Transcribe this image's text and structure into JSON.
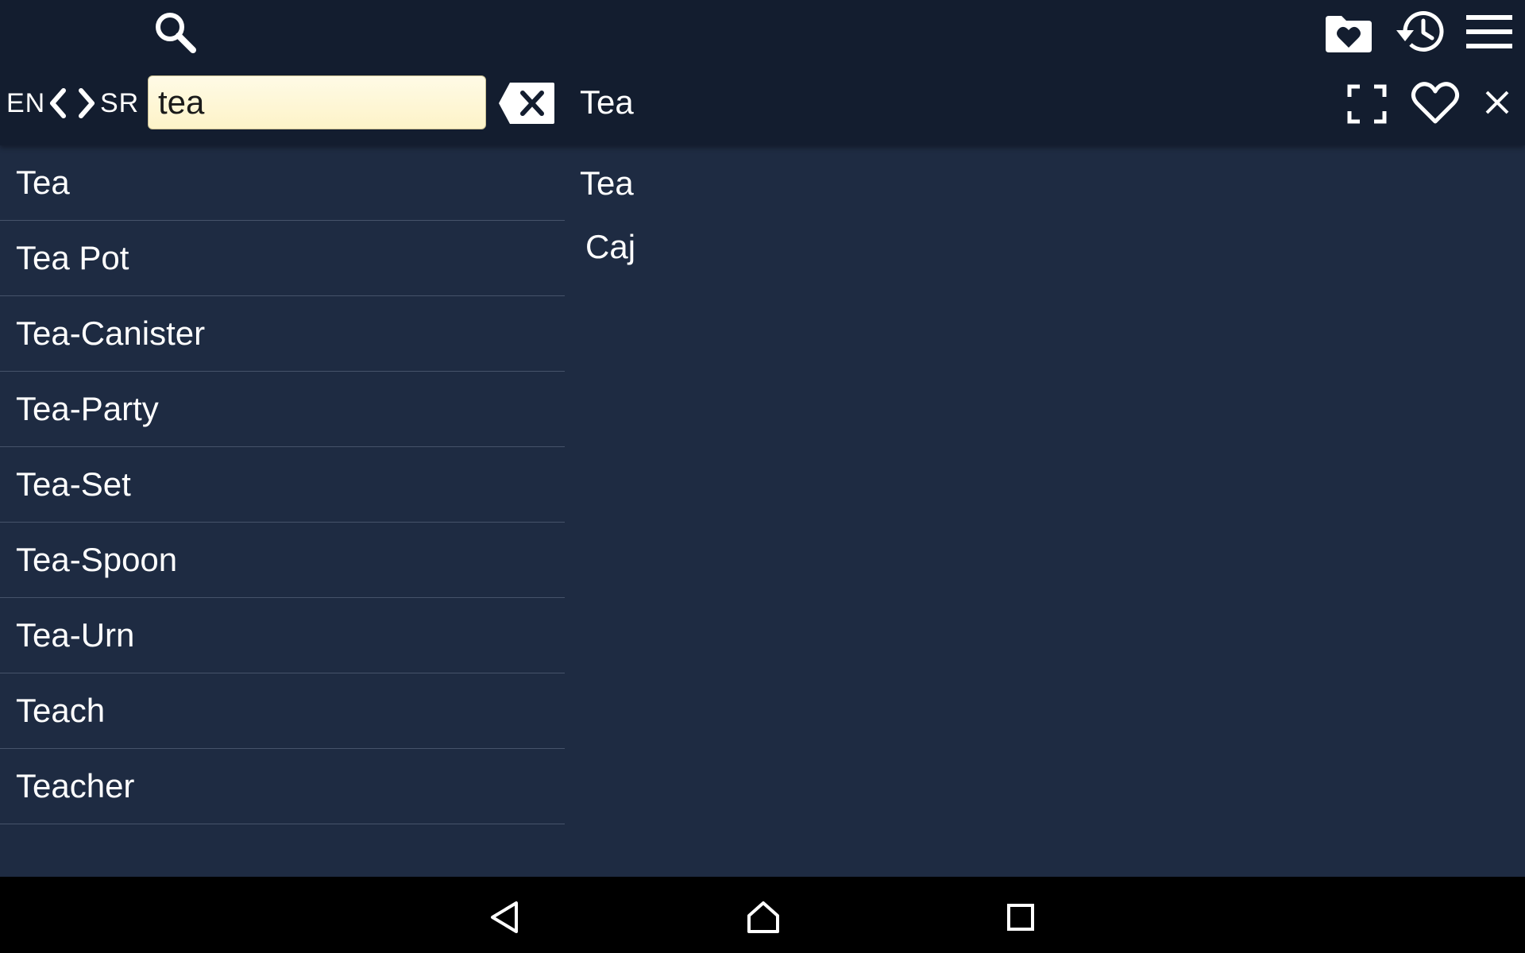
{
  "toolbar": {
    "icons": {
      "search": "search-icon",
      "favorites_folder": "heart-folder-icon",
      "history": "history-icon",
      "menu": "hamburger-menu-icon"
    }
  },
  "language": {
    "from": "EN",
    "to": "SR"
  },
  "search": {
    "value": "tea"
  },
  "detail": {
    "title": "Tea",
    "headword": "Tea",
    "translation": "Caj"
  },
  "word_list": [
    "Tea",
    "Tea Pot",
    "Tea-Canister",
    "Tea-Party",
    "Tea-Set",
    "Tea-Spoon",
    "Tea-Urn",
    "Teach",
    "Teacher"
  ],
  "colors": {
    "topbar_bg": "#131d2f",
    "content_bg": "#1e2b42",
    "input_bg": "#fdf3c8",
    "divider": "#46536a",
    "navbar_bg": "#000000"
  }
}
